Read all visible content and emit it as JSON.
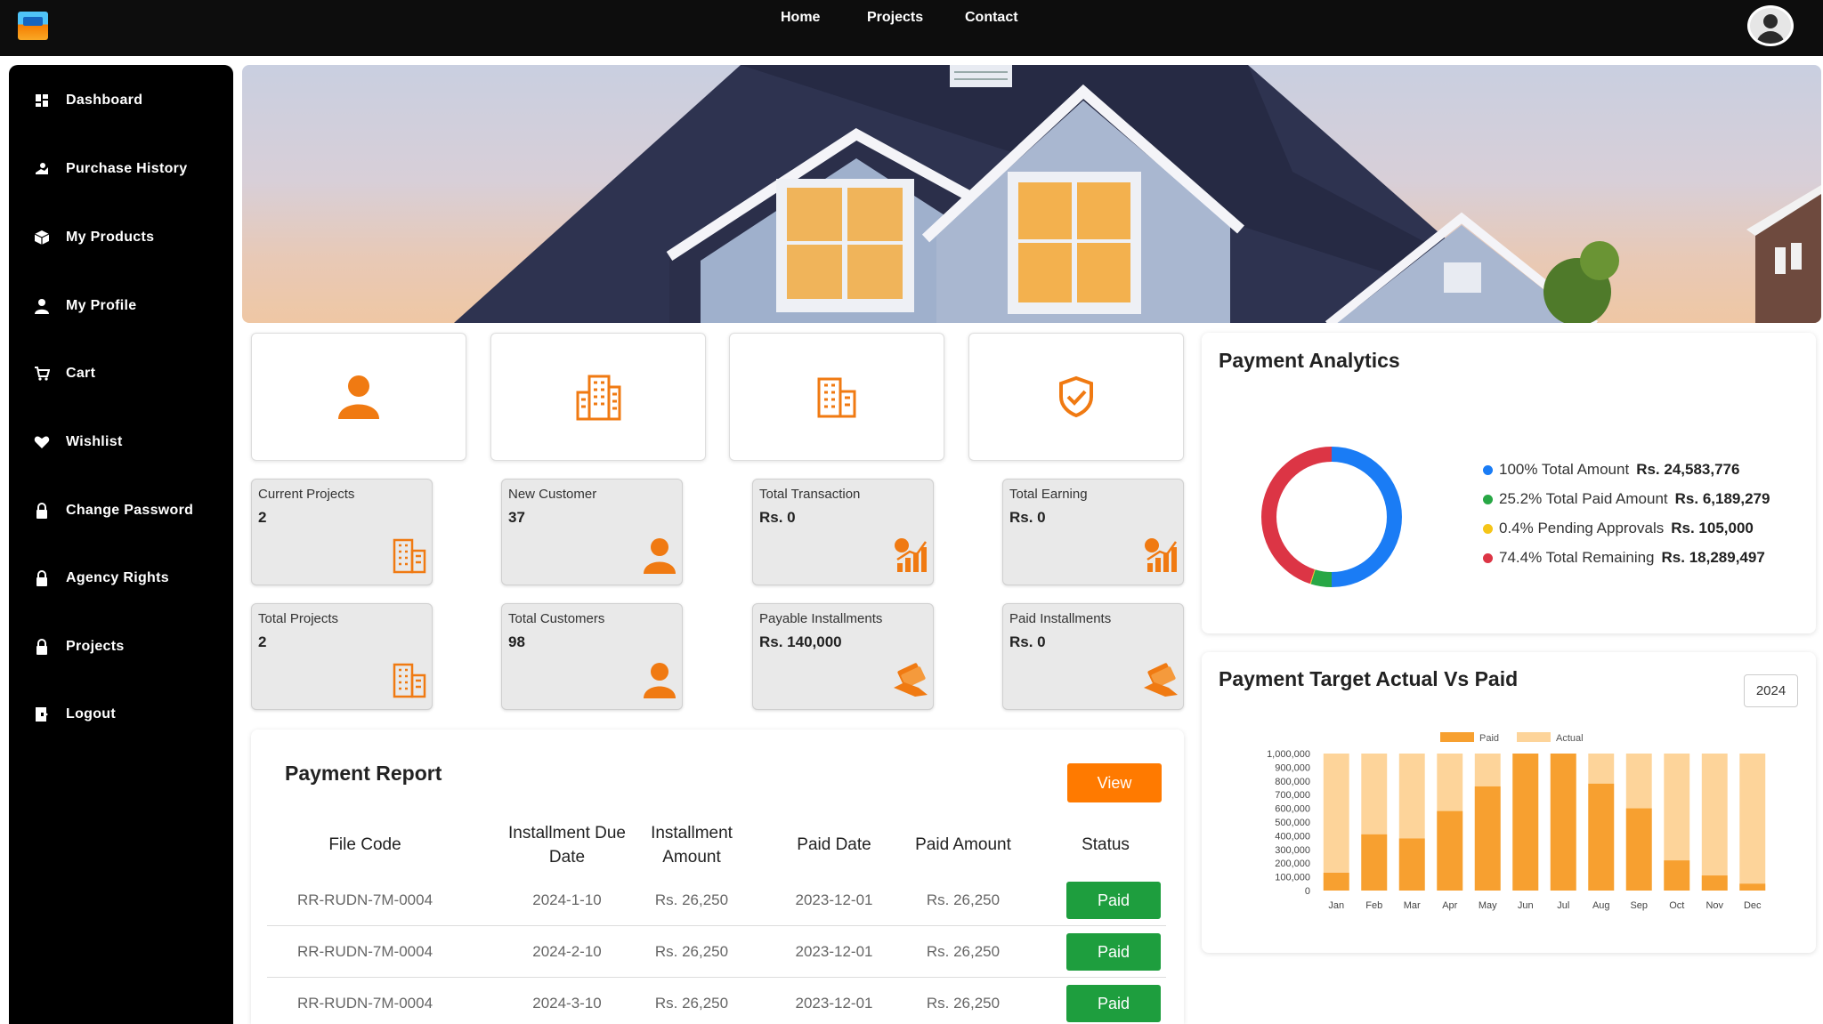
{
  "topbar": {
    "nav": [
      {
        "label": "Home",
        "name": "nav-home"
      },
      {
        "label": "Projects",
        "name": "nav-projects"
      },
      {
        "label": "Contact",
        "name": "nav-contact"
      }
    ]
  },
  "sidebar": {
    "items": [
      {
        "label": "Dashboard",
        "icon": "dashboard-icon"
      },
      {
        "label": "Purchase History",
        "icon": "purchase-history-icon"
      },
      {
        "label": "My Products",
        "icon": "products-icon"
      },
      {
        "label": "My Profile",
        "icon": "user-icon"
      },
      {
        "label": "Cart",
        "icon": "cart-icon"
      },
      {
        "label": "Wishlist",
        "icon": "heart-icon"
      },
      {
        "label": "Change Password",
        "icon": "lock-icon"
      },
      {
        "label": "Agency Rights",
        "icon": "lock-icon"
      },
      {
        "label": "Projects",
        "icon": "lock-icon"
      },
      {
        "label": "Logout",
        "icon": "logout-icon"
      }
    ]
  },
  "tiles": [
    {
      "icon": "user-icon"
    },
    {
      "icon": "buildings-icon"
    },
    {
      "icon": "building-icon"
    },
    {
      "icon": "shield-check-icon"
    }
  ],
  "stats": [
    {
      "label": "Current Projects",
      "value": "2",
      "icon": "building-icon"
    },
    {
      "label": "New Customer",
      "value": "37",
      "icon": "user-icon"
    },
    {
      "label": "Total Transaction",
      "value": "Rs. 0",
      "icon": "growth-chart-icon"
    },
    {
      "label": "Total Earning",
      "value": "Rs. 0",
      "icon": "growth-chart-icon"
    },
    {
      "label": "Total Projects",
      "value": "2",
      "icon": "building-icon"
    },
    {
      "label": "Total Customers",
      "value": "98",
      "icon": "user-icon"
    },
    {
      "label": "Payable Installments",
      "value": "Rs. 140,000",
      "icon": "money-hand-icon"
    },
    {
      "label": "Paid Installments",
      "value": "Rs. 0",
      "icon": "money-hand-icon"
    }
  ],
  "report": {
    "title": "Payment Report",
    "view_label": "View",
    "columns": [
      "File Code",
      "Installment Due Date",
      "Installment Amount",
      "Paid Date",
      "Paid Amount",
      "Status"
    ],
    "rows": [
      {
        "file_code": "RR-RUDN-7M-0004",
        "due_date": "2024-1-10",
        "amount": "Rs. 26,250",
        "paid_date": "2023-12-01",
        "paid_amount": "Rs. 26,250",
        "status": "Paid"
      },
      {
        "file_code": "RR-RUDN-7M-0004",
        "due_date": "2024-2-10",
        "amount": "Rs. 26,250",
        "paid_date": "2023-12-01",
        "paid_amount": "Rs. 26,250",
        "status": "Paid"
      },
      {
        "file_code": "RR-RUDN-7M-0004",
        "due_date": "2024-3-10",
        "amount": "Rs. 26,250",
        "paid_date": "2023-12-01",
        "paid_amount": "Rs. 26,250",
        "status": "Paid"
      }
    ]
  },
  "analytics": {
    "title": "Payment Analytics",
    "legend": [
      {
        "pct": "100% Total Amount",
        "amount": "Rs. 24,583,776",
        "color": "#1a7cf5"
      },
      {
        "pct": "25.2% Total Paid Amount",
        "amount": "Rs. 6,189,279",
        "color": "#28a745"
      },
      {
        "pct": "0.4% Pending Approvals",
        "amount": "Rs. 105,000",
        "color": "#f5c518"
      },
      {
        "pct": "74.4% Total Remaining",
        "amount": "Rs. 18,289,497",
        "color": "#dc3545"
      }
    ]
  },
  "chart_data": [
    {
      "type": "pie",
      "labels": [
        "Total Paid Amount",
        "Pending Approvals",
        "Total Remaining"
      ],
      "values": [
        25.2,
        0.4,
        74.4
      ],
      "colors": [
        "#28a745",
        "#f5c518",
        "#dc3545"
      ],
      "note_total_ring": {
        "label": "Total Amount",
        "value": 100,
        "color": "#1a7cf5"
      }
    },
    {
      "type": "bar",
      "title": "Payment Target Actual Vs Paid",
      "year": "2024",
      "categories": [
        "Jan",
        "Feb",
        "Mar",
        "Apr",
        "May",
        "Jun",
        "Jul",
        "Aug",
        "Sep",
        "Oct",
        "Nov",
        "Dec"
      ],
      "series": [
        {
          "name": "Paid",
          "color": "#f7a030",
          "values": [
            130000,
            410000,
            380000,
            580000,
            760000,
            1000000,
            1000000,
            780000,
            600000,
            220000,
            110000,
            50000
          ]
        },
        {
          "name": "Actual",
          "color": "#fdd49a",
          "values": [
            1000000,
            1000000,
            1000000,
            1000000,
            1000000,
            1000000,
            1000000,
            1000000,
            1000000,
            1000000,
            1000000,
            1000000
          ]
        }
      ],
      "ylim": [
        0,
        1000000
      ],
      "yticks": [
        "0",
        "100,000",
        "200,000",
        "300,000",
        "400,000",
        "500,000",
        "600,000",
        "700,000",
        "800,000",
        "900,000",
        "1,000,000"
      ]
    }
  ]
}
